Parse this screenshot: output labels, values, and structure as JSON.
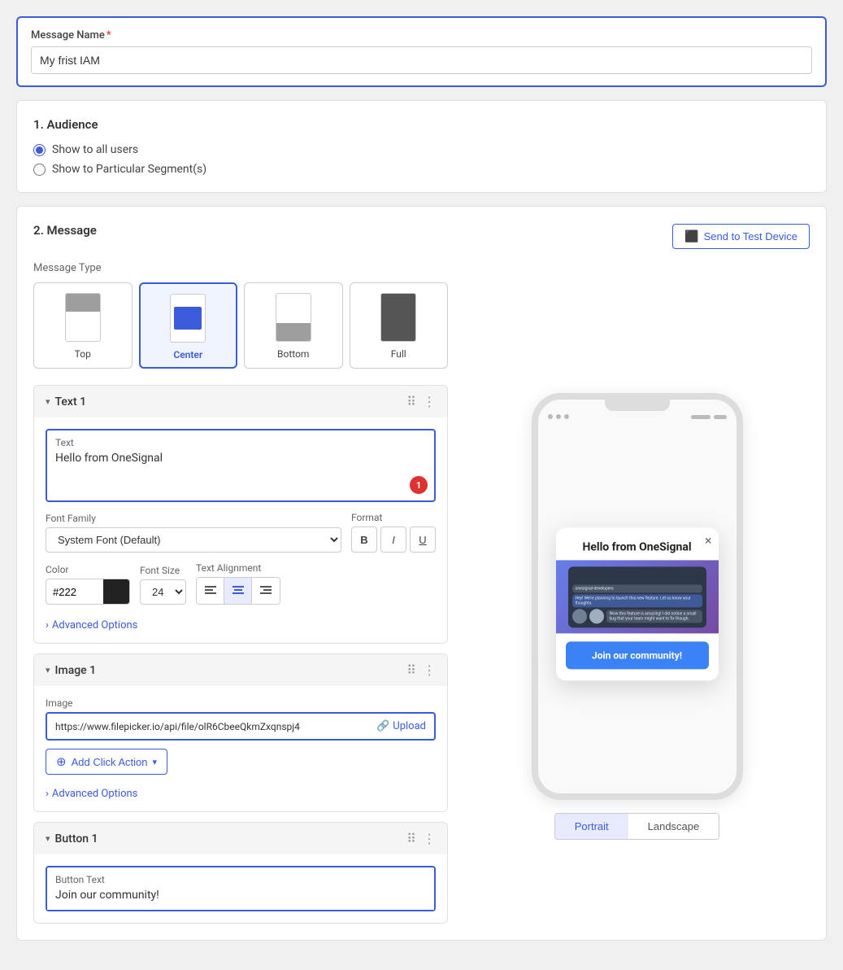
{
  "page": {
    "message_name_label": "Message Name",
    "required_marker": "*",
    "message_name_value": "My frist IAM"
  },
  "audience": {
    "section_title": "1. Audience",
    "radio_options": [
      {
        "label": "Show to all users",
        "selected": true
      },
      {
        "label": "Show to Particular Segment(s)",
        "selected": false
      }
    ]
  },
  "message": {
    "section_title": "2. Message",
    "send_test_btn": "Send to Test Device",
    "message_type_label": "Message Type",
    "types": [
      {
        "id": "top",
        "label": "Top",
        "selected": false
      },
      {
        "id": "center",
        "label": "Center",
        "selected": true
      },
      {
        "id": "bottom",
        "label": "Bottom",
        "selected": false
      },
      {
        "id": "full",
        "label": "Full",
        "selected": false
      }
    ]
  },
  "text1": {
    "header": "Text 1",
    "text_label": "Text",
    "text_value": "Hello from OneSignal",
    "char_count": "1",
    "font_family_label": "Font Family",
    "font_family_value": "System Font (Default)",
    "format_label": "Format",
    "format_buttons": [
      "B",
      "I",
      "U"
    ],
    "color_label": "Color",
    "color_value": "#222",
    "font_size_label": "Font Size",
    "font_size_value": "24",
    "text_align_label": "Text Alignment",
    "advanced_options": "Advanced Options"
  },
  "image1": {
    "header": "Image 1",
    "image_label": "Image",
    "image_url": "https://www.filepicker.io/api/file/olR6CbeeQkmZxqnspj4",
    "upload_label": "Upload",
    "add_click_action": "Add Click Action",
    "advanced_options": "Advanced Options"
  },
  "button1": {
    "header": "Button 1",
    "button_text_label": "Button Text",
    "button_text_value": "Join our community!"
  },
  "preview": {
    "modal_title": "Hello from OneSignal",
    "modal_button": "Join our community!",
    "close_icon": "×",
    "portrait_label": "Portrait",
    "landscape_label": "Landscape"
  }
}
